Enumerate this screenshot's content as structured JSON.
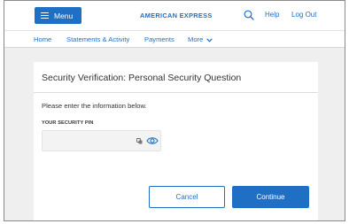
{
  "header": {
    "menu_label": "Menu",
    "brand": "AMERICAN EXPRESS",
    "help_label": "Help",
    "logout_label": "Log Out"
  },
  "nav": {
    "items": [
      {
        "label": "Home"
      },
      {
        "label": "Statements & Activity"
      },
      {
        "label": "Payments"
      },
      {
        "label": "More"
      }
    ]
  },
  "verification": {
    "title": "Security Verification: Personal Security Question",
    "instructions": "Please enter the information below.",
    "pin_label": "YOUR SECURITY PIN",
    "pin_value": "",
    "cancel_label": "Cancel",
    "continue_label": "Continue"
  },
  "colors": {
    "accent": "#1f6fc5",
    "background": "#efefef"
  },
  "icons": [
    "hamburger-icon",
    "search-icon",
    "chevron-down-icon",
    "key-icon",
    "eye-icon"
  ]
}
